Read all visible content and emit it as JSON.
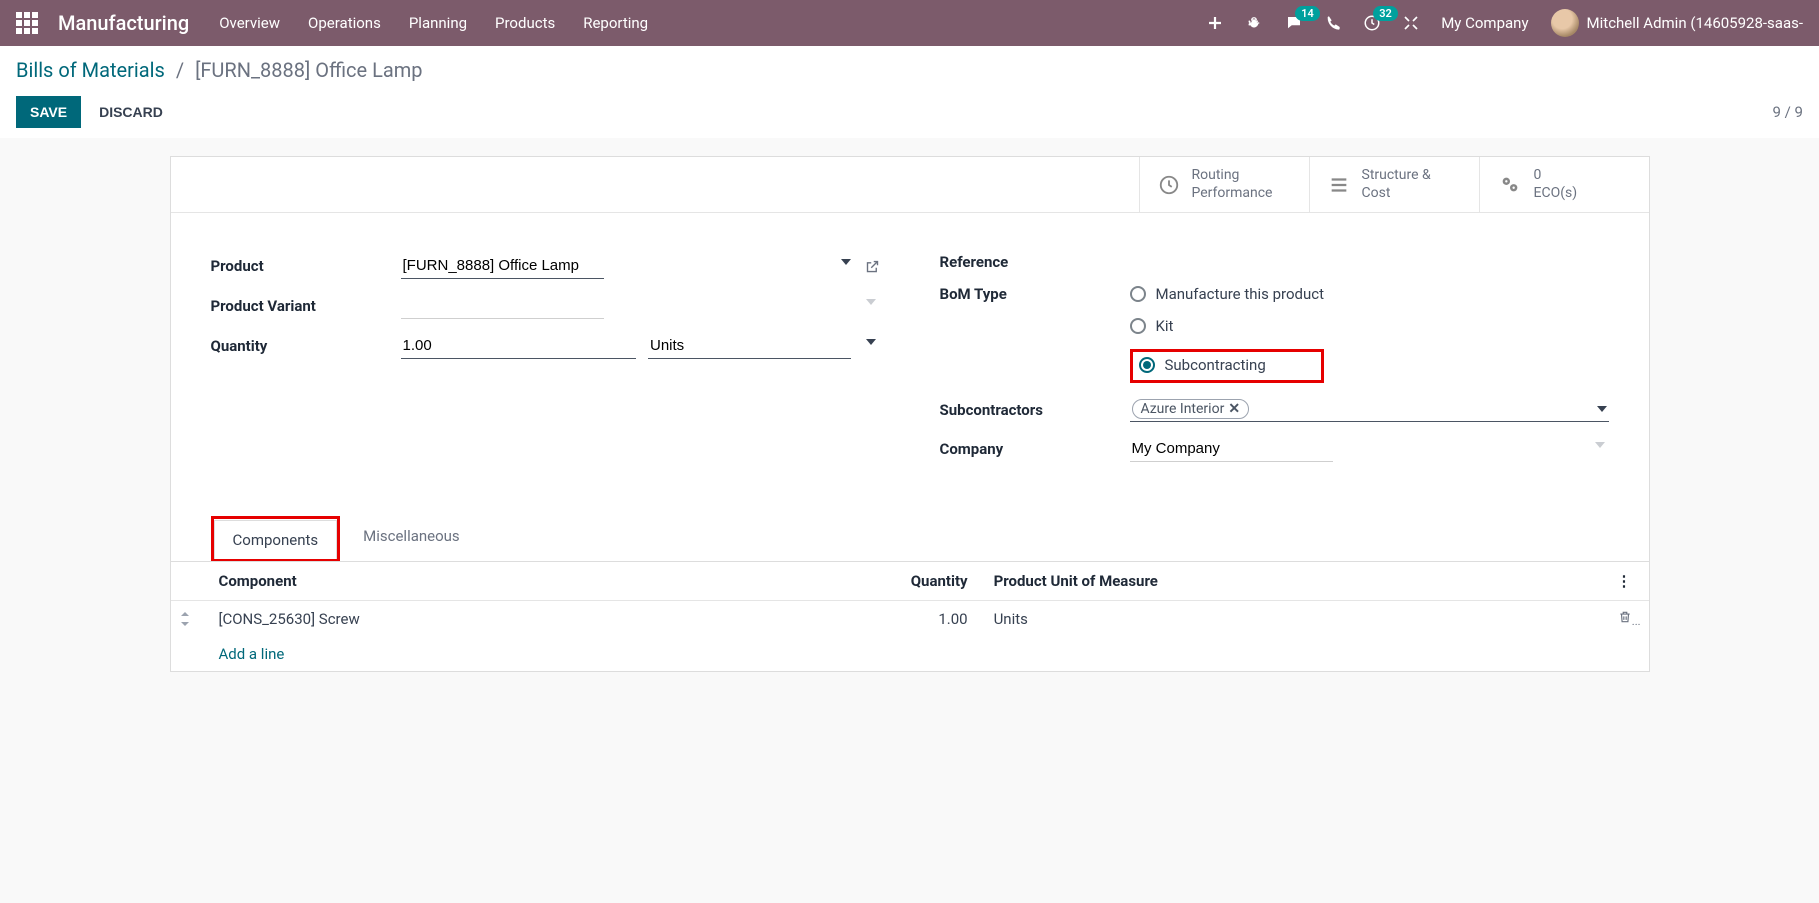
{
  "nav": {
    "brand": "Manufacturing",
    "menu": [
      "Overview",
      "Operations",
      "Planning",
      "Products",
      "Reporting"
    ],
    "msg_badge": "14",
    "activity_badge": "32",
    "company": "My Company",
    "user": "Mitchell Admin (14605928-saas-"
  },
  "breadcrumb": {
    "root": "Bills of Materials",
    "current": "[FURN_8888] Office Lamp"
  },
  "actions": {
    "save": "SAVE",
    "discard": "DISCARD"
  },
  "pager": "9 / 9",
  "stats": {
    "routing_l1": "Routing",
    "routing_l2": "Performance",
    "struct_l1": "Structure &",
    "struct_l2": "Cost",
    "eco_l1": "0",
    "eco_l2": "ECO(s)"
  },
  "form": {
    "labels": {
      "product": "Product",
      "variant": "Product Variant",
      "quantity": "Quantity",
      "reference": "Reference",
      "bom_type": "BoM Type",
      "subcontractors": "Subcontractors",
      "company": "Company"
    },
    "product": "[FURN_8888] Office Lamp",
    "quantity": "1.00",
    "uom": "Units",
    "bom_type_options": {
      "manufacture": "Manufacture this product",
      "kit": "Kit",
      "sub": "Subcontracting"
    },
    "subcontractor_tag": "Azure Interior",
    "company": "My Company"
  },
  "tabs": {
    "components": "Components",
    "misc": "Miscellaneous"
  },
  "table": {
    "headers": {
      "component": "Component",
      "qty": "Quantity",
      "uom": "Product Unit of Measure"
    },
    "row": {
      "component": "[CONS_25630] Screw",
      "qty": "1.00",
      "uom": "Units"
    },
    "add_line": "Add a line"
  }
}
